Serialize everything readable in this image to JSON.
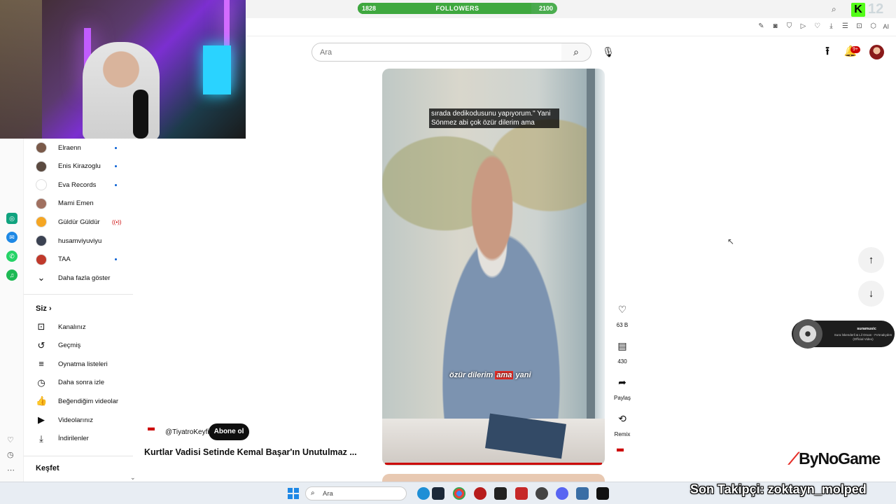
{
  "overlay": {
    "followers": {
      "current": "1828",
      "label": "FOLLOWERS",
      "goal": "2100",
      "progress": 0.87
    },
    "kick_count": "12",
    "ticker": "Son Takipçi: zoktayn_molped",
    "bynogame": {
      "prefix": "By",
      "brand": "NoGame"
    },
    "music": {
      "artist": "suramusic",
      "track": "Sura İskenderli & Lil Orxan - Fırtınalıydım (Official Video)"
    }
  },
  "toolbar": {
    "ai_label": "AI"
  },
  "header": {
    "search_placeholder": "Ara",
    "notifications_badge": "9+"
  },
  "sidebar": {
    "subscriptions": [
      {
        "name": "Elraenn",
        "color": "#7a5a4a",
        "status": "dot"
      },
      {
        "name": "Enis Kirazoglu",
        "color": "#5b4a40",
        "status": "dot"
      },
      {
        "name": "Eva Records",
        "color": "#ffffff",
        "status": "dot"
      },
      {
        "name": "Mami Emen",
        "color": "#a07060",
        "status": "none"
      },
      {
        "name": "Güldür Güldür",
        "color": "#f5a623",
        "status": "live"
      },
      {
        "name": "husamviyuviyu",
        "color": "#3b4252",
        "status": "none"
      },
      {
        "name": "TAA",
        "color": "#c0392b",
        "status": "dot"
      }
    ],
    "show_more": "Daha fazla göster",
    "you_title": "Siz",
    "you_items": [
      {
        "label": "Kanalınız",
        "icon": "channel-icon"
      },
      {
        "label": "Geçmiş",
        "icon": "history-icon"
      },
      {
        "label": "Oynatma listeleri",
        "icon": "playlists-icon"
      },
      {
        "label": "Daha sonra izle",
        "icon": "watch-later-icon"
      },
      {
        "label": "Beğendiğim videolar",
        "icon": "liked-icon"
      },
      {
        "label": "Videolarınız",
        "icon": "your-videos-icon"
      },
      {
        "label": "İndirilenler",
        "icon": "downloads-icon"
      }
    ],
    "explore_title": "Keşfet"
  },
  "video": {
    "caption_top": "sırada dedikodusunu yapıyorum.\" Yani Sönmez abi çok özür dilerim ama",
    "caption_bottom_pre": "özür dilerim ",
    "caption_bottom_hl": "ama",
    "caption_bottom_post": " yani",
    "channel": "@TiyatroKeyfi",
    "subscribe": "Abone ol",
    "title": "Kurtlar Vadisi Setinde Kemal Başar'ın Unutulmaz ..."
  },
  "actions": {
    "likes": "63 B",
    "comments": "430",
    "share": "Paylaş",
    "remix": "Remix"
  },
  "taskbar": {
    "search_placeholder": "Ara"
  }
}
